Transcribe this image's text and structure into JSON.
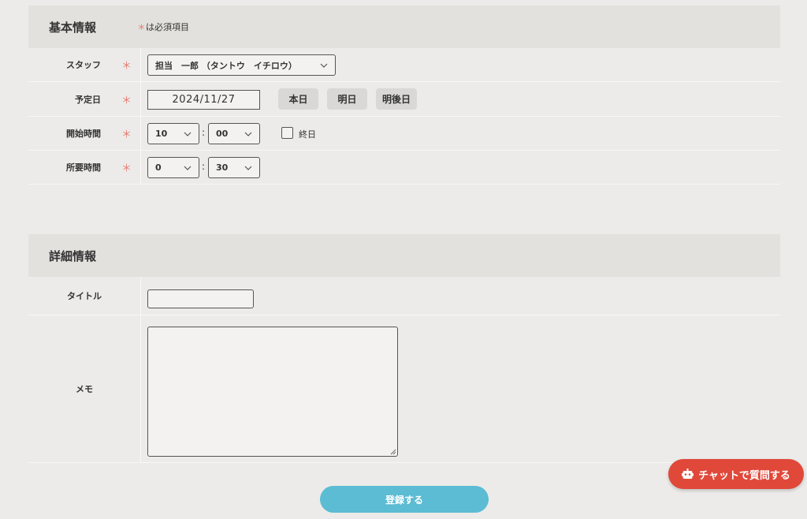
{
  "basic": {
    "title": "基本情報",
    "required_mark": "＊",
    "required_note": "は必須項目",
    "staff": {
      "label": "スタッフ",
      "value": "担当　一郎 （タントウ　イチロウ）"
    },
    "date": {
      "label": "予定日",
      "value": "2024/11/27",
      "today": "本日",
      "tomorrow": "明日",
      "day_after": "明後日"
    },
    "start": {
      "label": "開始時間",
      "hour": "10",
      "minute": "00",
      "separator": ":",
      "allday": "終日"
    },
    "duration": {
      "label": "所要時間",
      "hour": "0",
      "minute": "30",
      "separator": ":"
    }
  },
  "detail": {
    "title": "詳細情報",
    "title_field": {
      "label": "タイトル",
      "value": ""
    },
    "memo": {
      "label": "メモ",
      "value": ""
    }
  },
  "actions": {
    "submit": "登録する"
  },
  "chat": {
    "label": "チャットで質問する"
  },
  "colors": {
    "accent_submit": "#5bbcd3",
    "chat_button": "#e0483a",
    "required_star": "#e57a70"
  },
  "icons": {
    "chevron": "chevron-down-icon",
    "chat": "robot-icon"
  }
}
